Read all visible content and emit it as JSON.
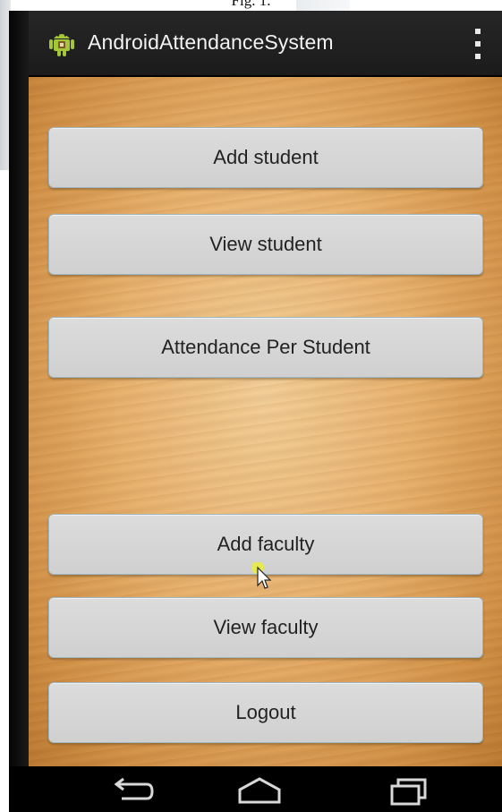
{
  "figure": {
    "caption": "Fig. 1."
  },
  "app": {
    "title": "AndroidAttendanceSystem"
  },
  "buttons": {
    "add_student": "Add student",
    "view_student": "View student",
    "attendance_per_student": "Attendance Per Student",
    "add_faculty": "Add faculty",
    "view_faculty": "View faculty",
    "logout": "Logout"
  },
  "icons": {
    "app": "android-icon",
    "menu": "overflow-menu-icon",
    "back": "back-icon",
    "home": "home-icon",
    "recents": "recent-apps-icon",
    "cursor": "mouse-pointer-icon"
  },
  "colors": {
    "action_bar": "#1f1f1f",
    "button_bg": "#d6d6d6",
    "button_border": "#9fb7c4",
    "wood": "#e7b06c"
  }
}
